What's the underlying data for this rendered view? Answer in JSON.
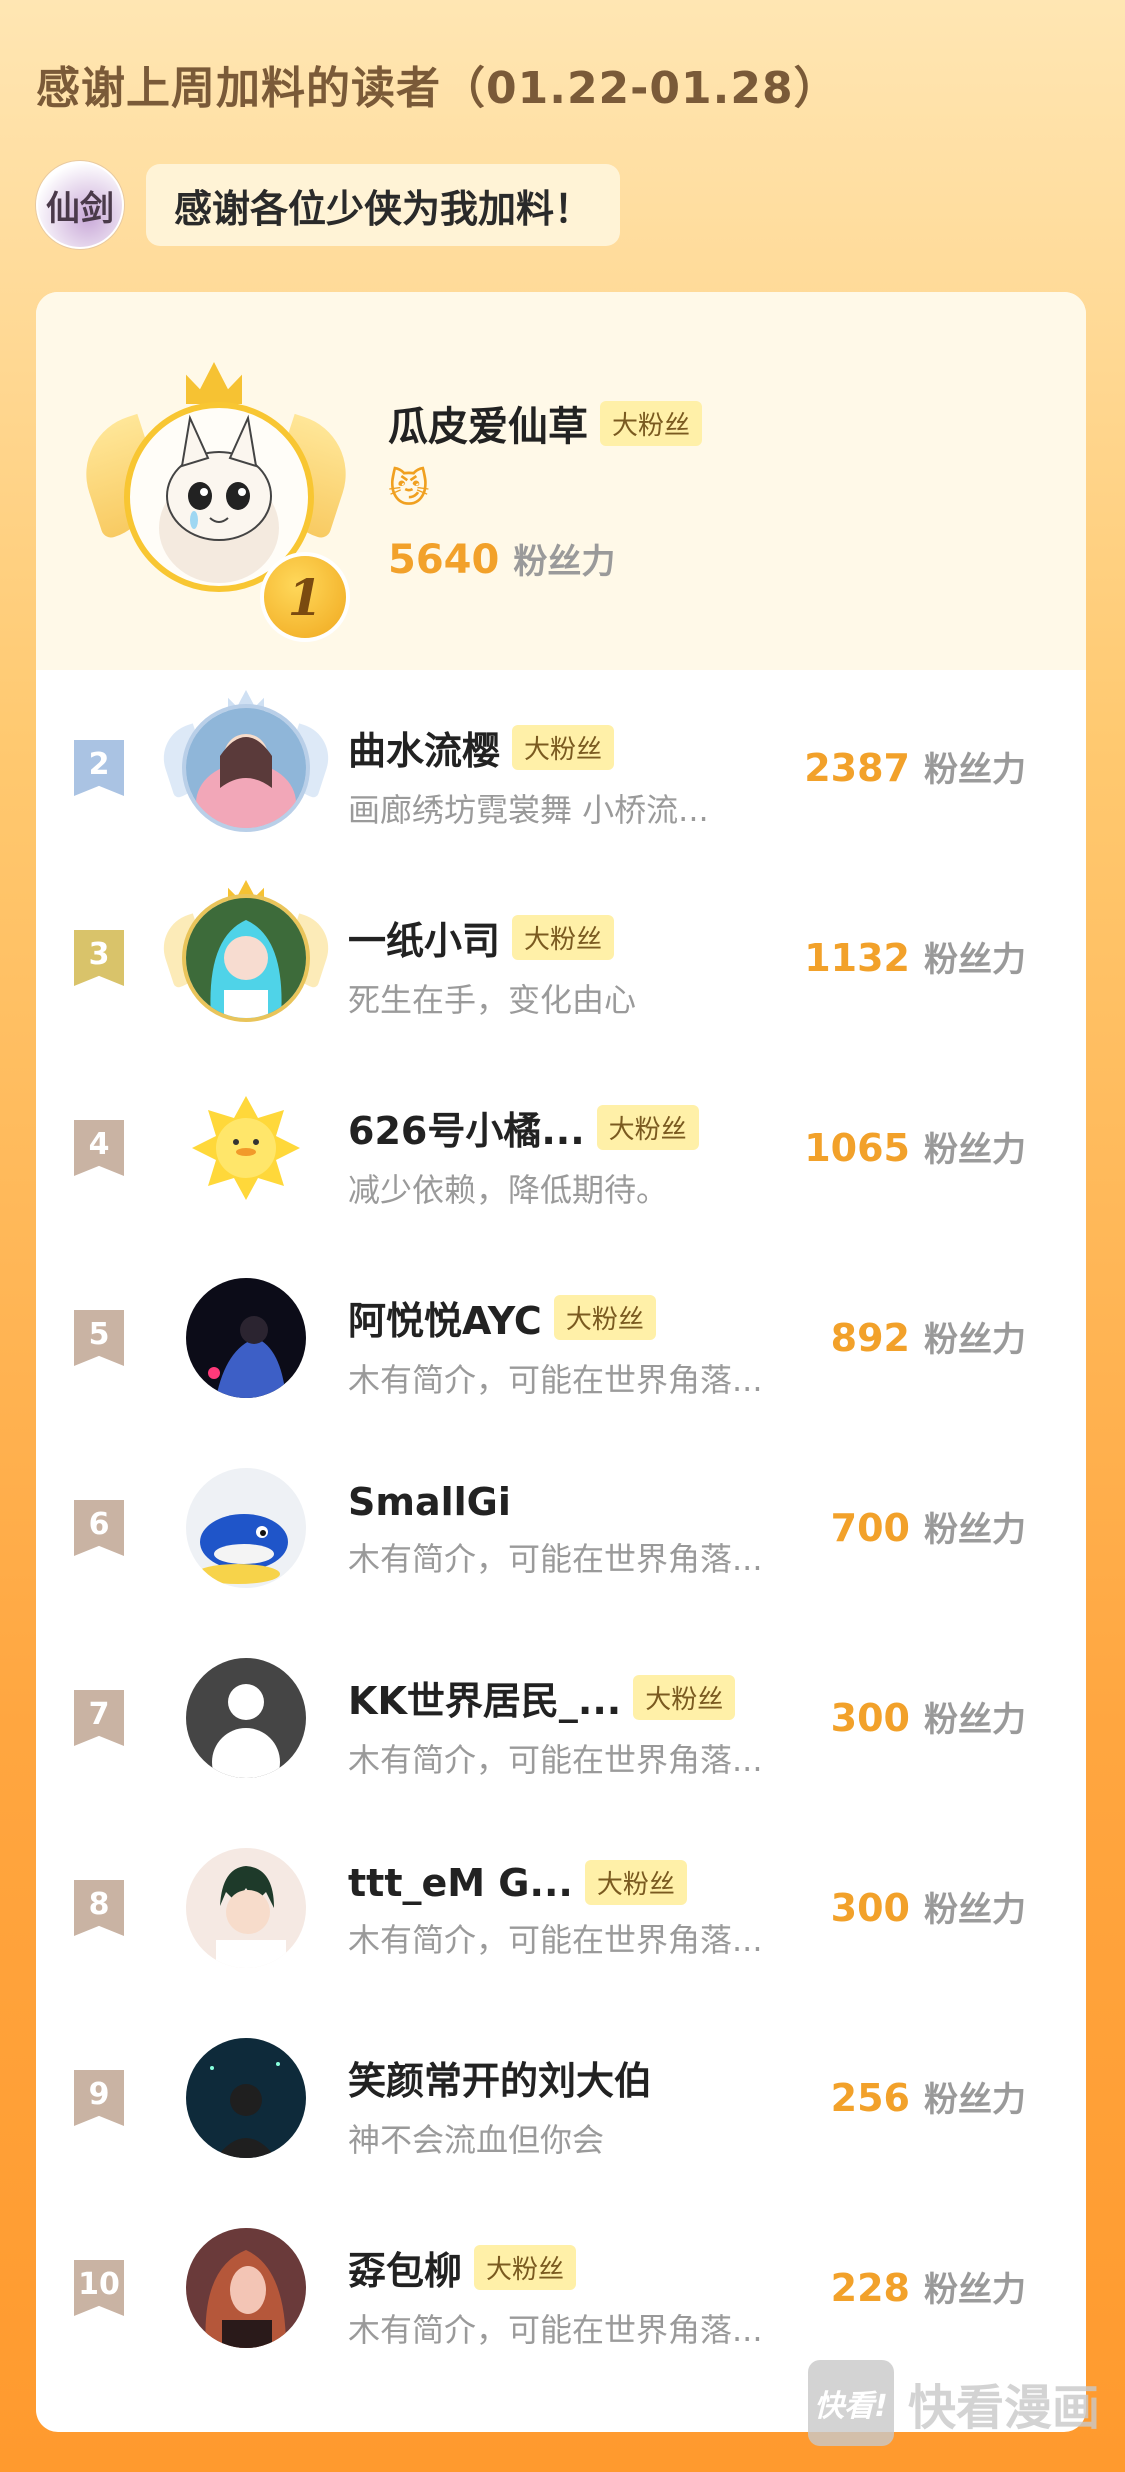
{
  "header": {
    "title": "感谢上周加料的读者（01.22-01.28）"
  },
  "author": {
    "avatar_text": "仙剑",
    "message": "感谢各位少侠为我加料！"
  },
  "top1": {
    "rank": "1",
    "name": "瓜皮爱仙草",
    "tag": "大粉丝",
    "emoji": "😼",
    "score": "5640",
    "unit": "粉丝力"
  },
  "rows": [
    {
      "rank": "2",
      "name": "曲水流樱",
      "tag": "大粉丝",
      "desc": "画廊绣坊霓裳舞 小桥流...",
      "score": "2387",
      "unit": "粉丝力"
    },
    {
      "rank": "3",
      "name": "一纸小司",
      "tag": "大粉丝",
      "desc": "死生在手，变化由心",
      "score": "1132",
      "unit": "粉丝力"
    },
    {
      "rank": "4",
      "name": "626号小橘...",
      "tag": "大粉丝",
      "desc": "减少依赖，降低期待。",
      "score": "1065",
      "unit": "粉丝力"
    },
    {
      "rank": "5",
      "name": "阿悦悦AYC",
      "tag": "大粉丝",
      "desc": "木有简介，可能在世界角落...",
      "score": "892",
      "unit": "粉丝力"
    },
    {
      "rank": "6",
      "name": "SmallGi",
      "tag": "",
      "desc": "木有简介，可能在世界角落...",
      "score": "700",
      "unit": "粉丝力"
    },
    {
      "rank": "7",
      "name": "KK世界居民_...",
      "tag": "大粉丝",
      "desc": "木有简介，可能在世界角落...",
      "score": "300",
      "unit": "粉丝力"
    },
    {
      "rank": "8",
      "name": "ttt_eM G...",
      "tag": "大粉丝",
      "desc": "木有简介，可能在世界角落...",
      "score": "300",
      "unit": "粉丝力"
    },
    {
      "rank": "9",
      "name": "笑颜常开的刘大伯",
      "tag": "",
      "desc": "神不会流血但你会",
      "score": "256",
      "unit": "粉丝力"
    },
    {
      "rank": "10",
      "name": "孬包柳",
      "tag": "大粉丝",
      "desc": "木有简介，可能在世界角落...",
      "score": "228",
      "unit": "粉丝力"
    }
  ],
  "colors": {
    "rank2_flag": "#aac3e3",
    "rank3_flag": "#d9c36a",
    "rank_other_flag": "#c9b3a3",
    "score": "#f2a12a",
    "tag_bg": "#fff0a8"
  },
  "watermark": {
    "icon": "快看!",
    "text": "快看漫画"
  }
}
